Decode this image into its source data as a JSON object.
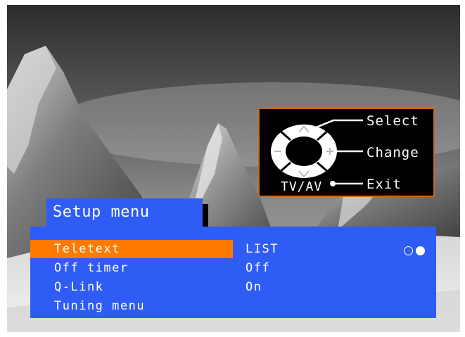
{
  "help_box": {
    "select_label": "Select",
    "change_label": "Change",
    "exit_label": "Exit",
    "tvav_label": "TV/AV"
  },
  "menu": {
    "title": "Setup menu",
    "items": [
      {
        "label": "Teletext",
        "value": "LIST",
        "selected": true
      },
      {
        "label": "Off timer",
        "value": "Off",
        "selected": false
      },
      {
        "label": "Q-Link",
        "value": "On",
        "selected": false
      },
      {
        "label": "Tuning menu",
        "value": "",
        "selected": false
      }
    ],
    "page_indicator": {
      "total": 2,
      "current": 2
    }
  },
  "colors": {
    "menu_blue": "#2f5cf5",
    "highlight_orange": "#ff7a00",
    "help_border": "#c46a1a"
  }
}
